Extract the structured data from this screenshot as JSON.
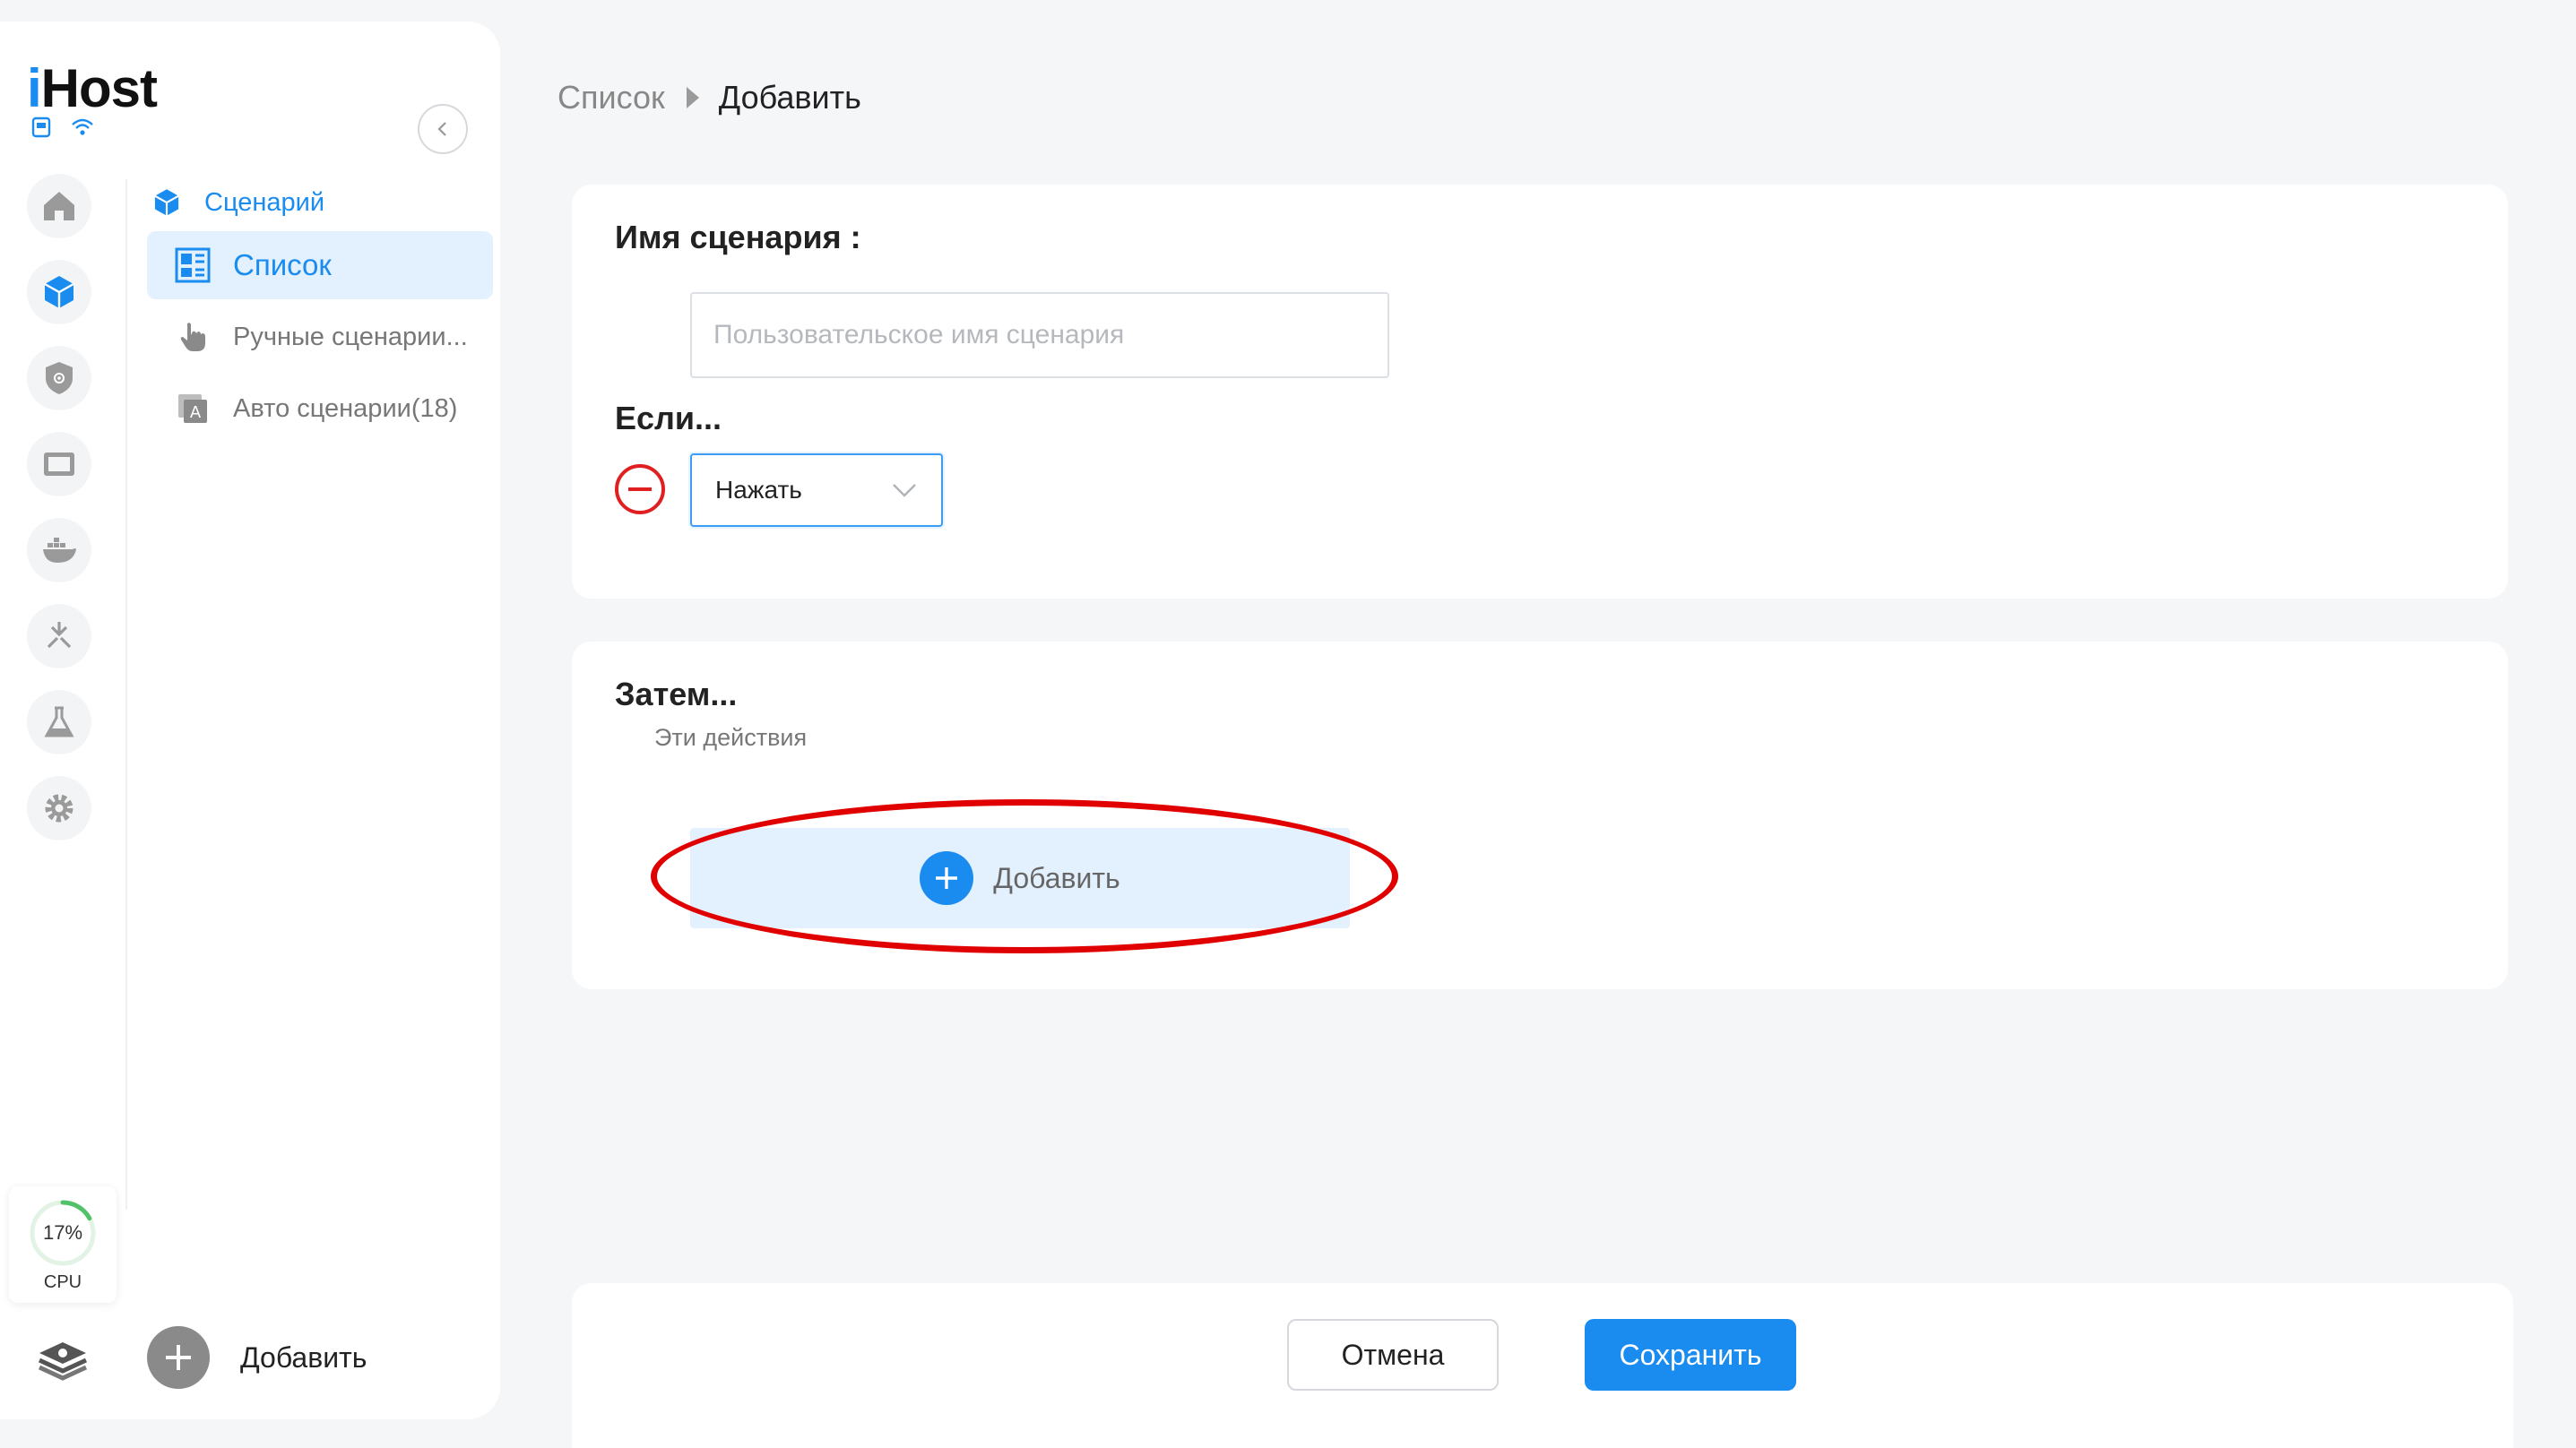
{
  "app": {
    "logo_prefix": "i",
    "logo_rest": "Host",
    "status_icons": [
      "sd-card-icon",
      "wifi-icon"
    ]
  },
  "colors": {
    "accent": "#1a8cf0",
    "danger": "#e02020",
    "highlight": "#e00000",
    "active_bg": "#e3f0fd"
  },
  "rail": {
    "items": [
      {
        "icon": "home-icon",
        "active": false
      },
      {
        "icon": "scene-cube-icon",
        "active": true
      },
      {
        "icon": "security-shield-icon",
        "active": false
      },
      {
        "icon": "camera-screen-icon",
        "active": false
      },
      {
        "icon": "docker-icon",
        "active": false
      },
      {
        "icon": "matter-icon",
        "active": false
      },
      {
        "icon": "lab-flask-icon",
        "active": false
      },
      {
        "icon": "settings-gear-icon",
        "active": false
      }
    ]
  },
  "subnav": {
    "group_label": "Сценарий",
    "items": [
      {
        "label": "Список",
        "icon": "list-grid-icon",
        "active": true
      },
      {
        "label": "Ручные сценарии...",
        "icon": "hand-pointer-icon",
        "active": false
      },
      {
        "label": "Авто сценарии(18)",
        "icon": "auto-scene-icon",
        "active": false
      }
    ]
  },
  "cpu": {
    "percent_text": "17%",
    "percent": 17,
    "caption": "CPU"
  },
  "sidebar_footer": {
    "add_label": "Добавить"
  },
  "breadcrumb": {
    "previous": "Список",
    "current": "Добавить"
  },
  "scene_form": {
    "name_label": "Имя сценария :",
    "name_placeholder": "Пользовательское имя сценария",
    "name_value": "",
    "if_label": "Если...",
    "trigger_value": "Нажать"
  },
  "actions": {
    "then_label": "Затем...",
    "subtitle": "Эти действия",
    "add_label": "Добавить"
  },
  "footer": {
    "cancel_label": "Отмена",
    "save_label": "Сохранить"
  }
}
